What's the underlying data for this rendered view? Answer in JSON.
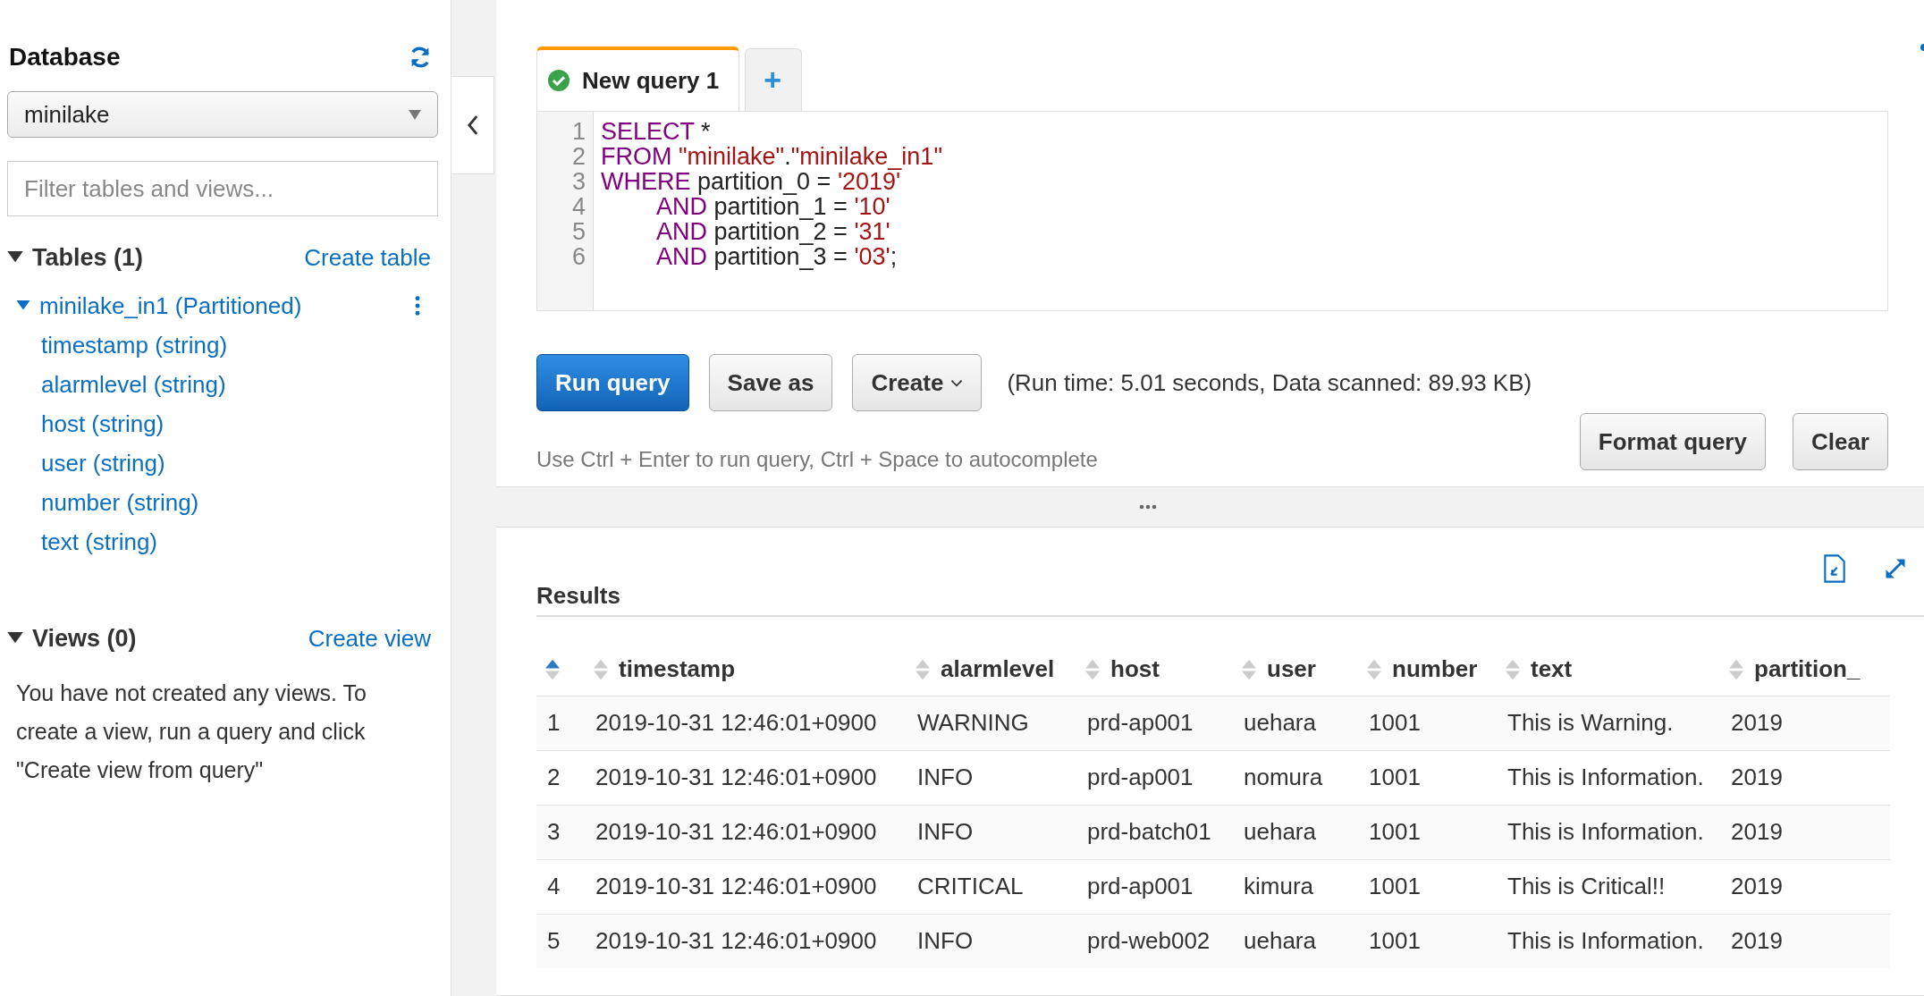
{
  "sidebar": {
    "title": "Database",
    "database_select": {
      "value": "minilake"
    },
    "filter": {
      "placeholder": "Filter tables and views..."
    },
    "tables": {
      "heading": "Tables (1)",
      "expanded": true,
      "action": "Create table",
      "items": [
        {
          "name": "minilake_in1 (Partitioned)",
          "expanded": true,
          "children": [
            {
              "name": "timestamp (string)"
            },
            {
              "name": "alarmlevel (string)"
            },
            {
              "name": "host (string)"
            },
            {
              "name": "user (string)"
            },
            {
              "name": "number (string)"
            },
            {
              "name": "text (string)"
            }
          ]
        }
      ]
    },
    "views": {
      "heading": "Views (0)",
      "expanded": true,
      "action": "Create view",
      "empty_message": "You have not created any views. To create a view, run a query and click \"Create view from query\""
    }
  },
  "editor": {
    "tabs": [
      {
        "kind": "query",
        "label": "New query 1",
        "succeeded": true,
        "selected": true
      },
      {
        "kind": "add",
        "label": "+",
        "selected": false
      }
    ],
    "lines": [
      {
        "number": "1",
        "indented": false,
        "tokens": [
          {
            "kind": "keyword",
            "text": "SELECT"
          },
          {
            "kind": "plain",
            "text": " *"
          }
        ]
      },
      {
        "number": "2",
        "indented": false,
        "tokens": [
          {
            "kind": "keyword",
            "text": "FROM"
          },
          {
            "kind": "string",
            "text": " \"minilake\""
          },
          {
            "kind": "plain",
            "text": "."
          },
          {
            "kind": "string",
            "text": "\"minilake_in1\""
          }
        ]
      },
      {
        "number": "3",
        "indented": false,
        "tokens": [
          {
            "kind": "keyword",
            "text": "WHERE"
          },
          {
            "kind": "plain",
            "text": " partition_0 = "
          },
          {
            "kind": "string",
            "text": "'2019'"
          }
        ]
      },
      {
        "number": "4",
        "indented": true,
        "tokens": [
          {
            "kind": "keyword",
            "text": "AND"
          },
          {
            "kind": "plain",
            "text": " partition_1 = "
          },
          {
            "kind": "string",
            "text": "'10'"
          }
        ]
      },
      {
        "number": "5",
        "indented": true,
        "tokens": [
          {
            "kind": "keyword",
            "text": "AND"
          },
          {
            "kind": "plain",
            "text": " partition_2 = "
          },
          {
            "kind": "string",
            "text": "'31'"
          }
        ]
      },
      {
        "number": "6",
        "indented": true,
        "tokens": [
          {
            "kind": "keyword",
            "text": "AND"
          },
          {
            "kind": "plain",
            "text": " partition_3 = "
          },
          {
            "kind": "string",
            "text": "'03'"
          },
          {
            "kind": "plain",
            "text": ";"
          }
        ]
      }
    ],
    "actions": [
      {
        "kind": "primary",
        "label": "Run query"
      },
      {
        "kind": "default",
        "label": "Save as"
      },
      {
        "kind": "dropdown",
        "label": "Create"
      }
    ],
    "run_status": "(Run time: 5.01 seconds, Data scanned: 89.93 KB)",
    "hint": "Use Ctrl + Enter to run query, Ctrl + Space to autocomplete",
    "secondary_actions": [
      {
        "label": "Format query"
      },
      {
        "label": "Clear"
      }
    ]
  },
  "results": {
    "title": "Results",
    "columns": [
      {
        "sorted": true
      },
      {
        "label": "timestamp",
        "sorted": false
      },
      {
        "label": "alarmlevel",
        "sorted": false
      },
      {
        "label": "host",
        "sorted": false
      },
      {
        "label": "user",
        "sorted": false
      },
      {
        "label": "number",
        "sorted": false
      },
      {
        "label": "text",
        "sorted": false
      },
      {
        "label": "partition_",
        "sorted": false
      }
    ],
    "rows": [
      [
        "1",
        "2019-10-31 12:46:01+0900",
        "WARNING",
        "prd-ap001",
        "uehara",
        "1001",
        "This is Warning.",
        "2019"
      ],
      [
        "2",
        "2019-10-31 12:46:01+0900",
        "INFO",
        "prd-ap001",
        "nomura",
        "1001",
        "This is Information.",
        "2019"
      ],
      [
        "3",
        "2019-10-31 12:46:01+0900",
        "INFO",
        "prd-batch01",
        "uehara",
        "1001",
        "This is Information.",
        "2019"
      ],
      [
        "4",
        "2019-10-31 12:46:01+0900",
        "CRITICAL",
        "prd-ap001",
        "kimura",
        "1001",
        "This is Critical!!",
        "2019"
      ],
      [
        "5",
        "2019-10-31 12:46:01+0900",
        "INFO",
        "prd-web002",
        "uehara",
        "1001",
        "This is Information.",
        "2019"
      ]
    ]
  }
}
